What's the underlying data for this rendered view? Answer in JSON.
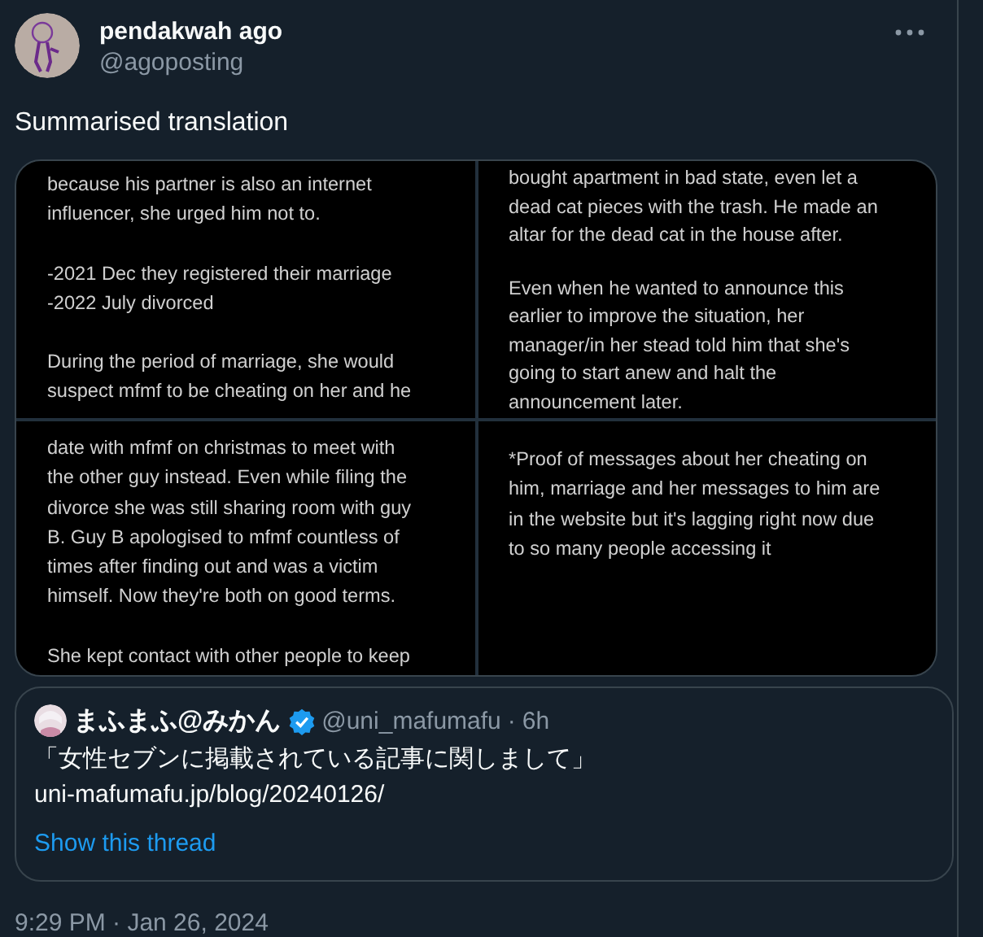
{
  "author": {
    "name": "pendakwah ago",
    "handle": "@agoposting"
  },
  "text": "Summarised translation",
  "images": [
    {
      "paragraphs": [
        [
          "because his partner is also an internet",
          "influencer, she urged him not to."
        ],
        [
          "-2021 Dec they registered their marriage",
          "-2022 July divorced"
        ],
        [
          "During the period of marriage, she would",
          "suspect mfmf to be cheating on her and he"
        ]
      ]
    },
    {
      "paragraphs": [
        [
          "bought apartment in bad state, even let a",
          "dead cat pieces with the trash. He made an",
          "altar for the dead cat in the house after."
        ],
        [
          "Even when he wanted to announce this",
          "earlier to improve the situation, her",
          "manager/in her stead told him that she's",
          "going to start anew and halt the",
          "announcement later."
        ]
      ]
    },
    {
      "paragraphs": [
        [
          "date with mfmf on christmas to meet with",
          "the other guy instead. Even while filing the",
          "divorce she was still sharing room with guy",
          "B. Guy B apologised to mfmf countless of",
          "times after finding out and was a victim",
          "himself. Now they're both on good terms."
        ],
        [
          "She kept contact with other people to keep"
        ]
      ]
    },
    {
      "paragraphs": [
        [
          "*Proof of messages about her cheating on",
          "him, marriage and her messages to him are",
          "in the website but it's lagging right now due",
          "to so many people accessing it"
        ]
      ]
    }
  ],
  "quote": {
    "name": "まふまふ@みかん",
    "verified": true,
    "handle": "@uni_mafumafu",
    "separator": "·",
    "time": "6h",
    "text": "「女性セブンに掲載されている記事に関しまして」",
    "link": "uni-mafumafu.jp/blog/20240126/",
    "thread": "Show this thread"
  },
  "timestamp": "9:29 PM · Jan 26, 2024"
}
